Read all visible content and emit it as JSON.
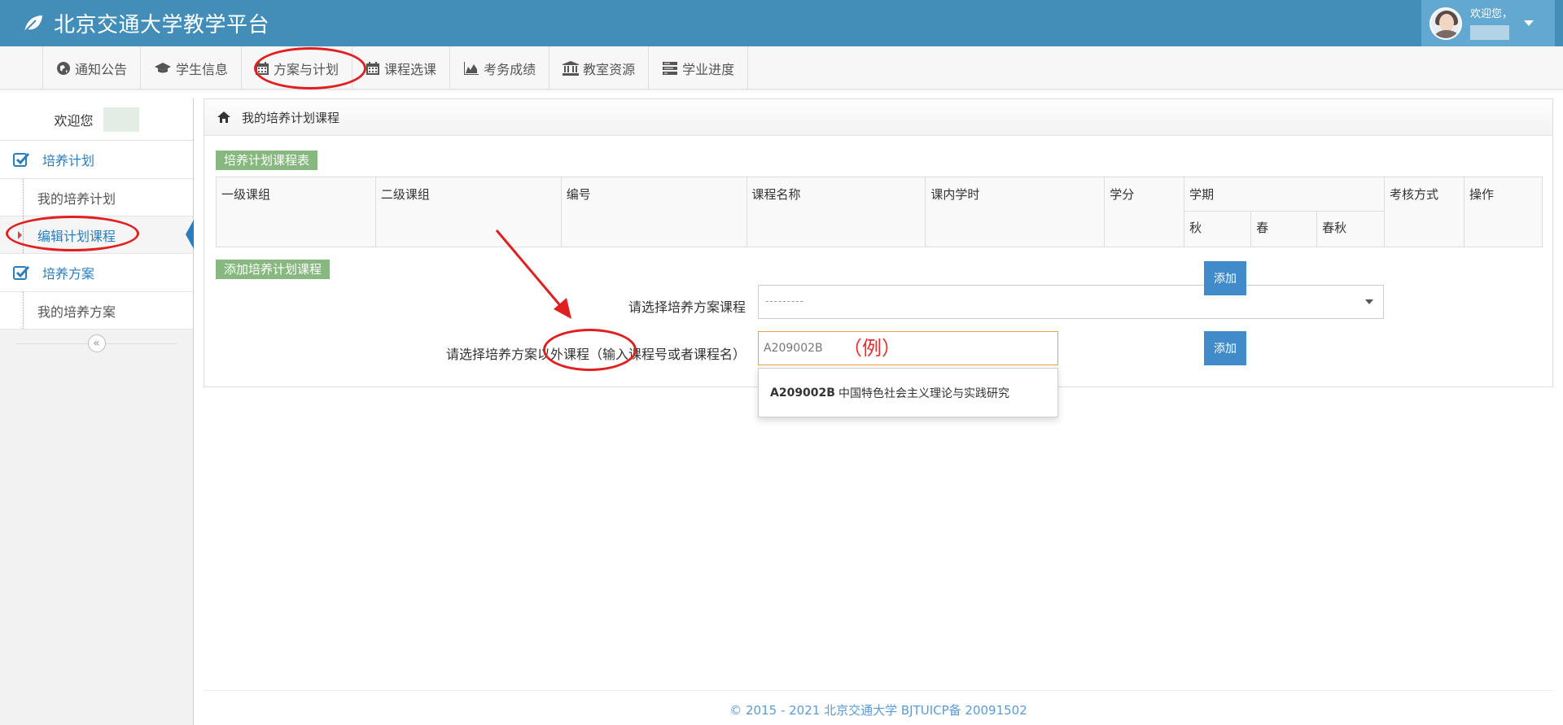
{
  "header": {
    "title": "北京交通大学教学平台",
    "user_greeting": "欢迎您，"
  },
  "nav": [
    {
      "label": "通知公告",
      "icon": "globe-icon"
    },
    {
      "label": "学生信息",
      "icon": "graduation-cap-icon"
    },
    {
      "label": "方案与计划",
      "icon": "calendar-icon"
    },
    {
      "label": "课程选课",
      "icon": "calendar-icon"
    },
    {
      "label": "考务成绩",
      "icon": "area-chart-icon"
    },
    {
      "label": "教室资源",
      "icon": "institution-icon"
    },
    {
      "label": "学业进度",
      "icon": "tasks-icon"
    }
  ],
  "sidebar": {
    "welcome": "欢迎您",
    "groups": [
      {
        "title": "培养计划",
        "items": [
          "我的培养计划",
          "编辑计划课程"
        ]
      },
      {
        "title": "培养方案",
        "items": [
          "我的培养方案"
        ]
      }
    ]
  },
  "panel": {
    "breadcrumb": "我的培养计划课程",
    "table_tag": "培养计划课程表",
    "columns": [
      "一级课组",
      "二级课组",
      "编号",
      "课程名称",
      "课内学时",
      "学分",
      "学期",
      "考核方式",
      "操作"
    ],
    "term_columns": [
      "秋",
      "春",
      "春秋"
    ],
    "add_tag": "添加培养计划课程",
    "select_label": "请选择培养方案课程",
    "select_value": "---------",
    "input_label": "请选择培养方案以外课程（输入课程号或者课程名）",
    "input_value": "A209002B",
    "add_button": "添加",
    "example_note": "（例）",
    "suggestion_code": "A209002B",
    "suggestion_name": "中国特色社会主义理论与实践研究"
  },
  "footer": "© 2015 - 2021 北京交通大学 BJTUICP备 20091502",
  "colors": {
    "header_bg": "#438eb9",
    "link_blue": "#2b7dbc",
    "tag_green": "#87b87f",
    "button_blue": "#428bca",
    "annotation_red": "#e02020"
  }
}
